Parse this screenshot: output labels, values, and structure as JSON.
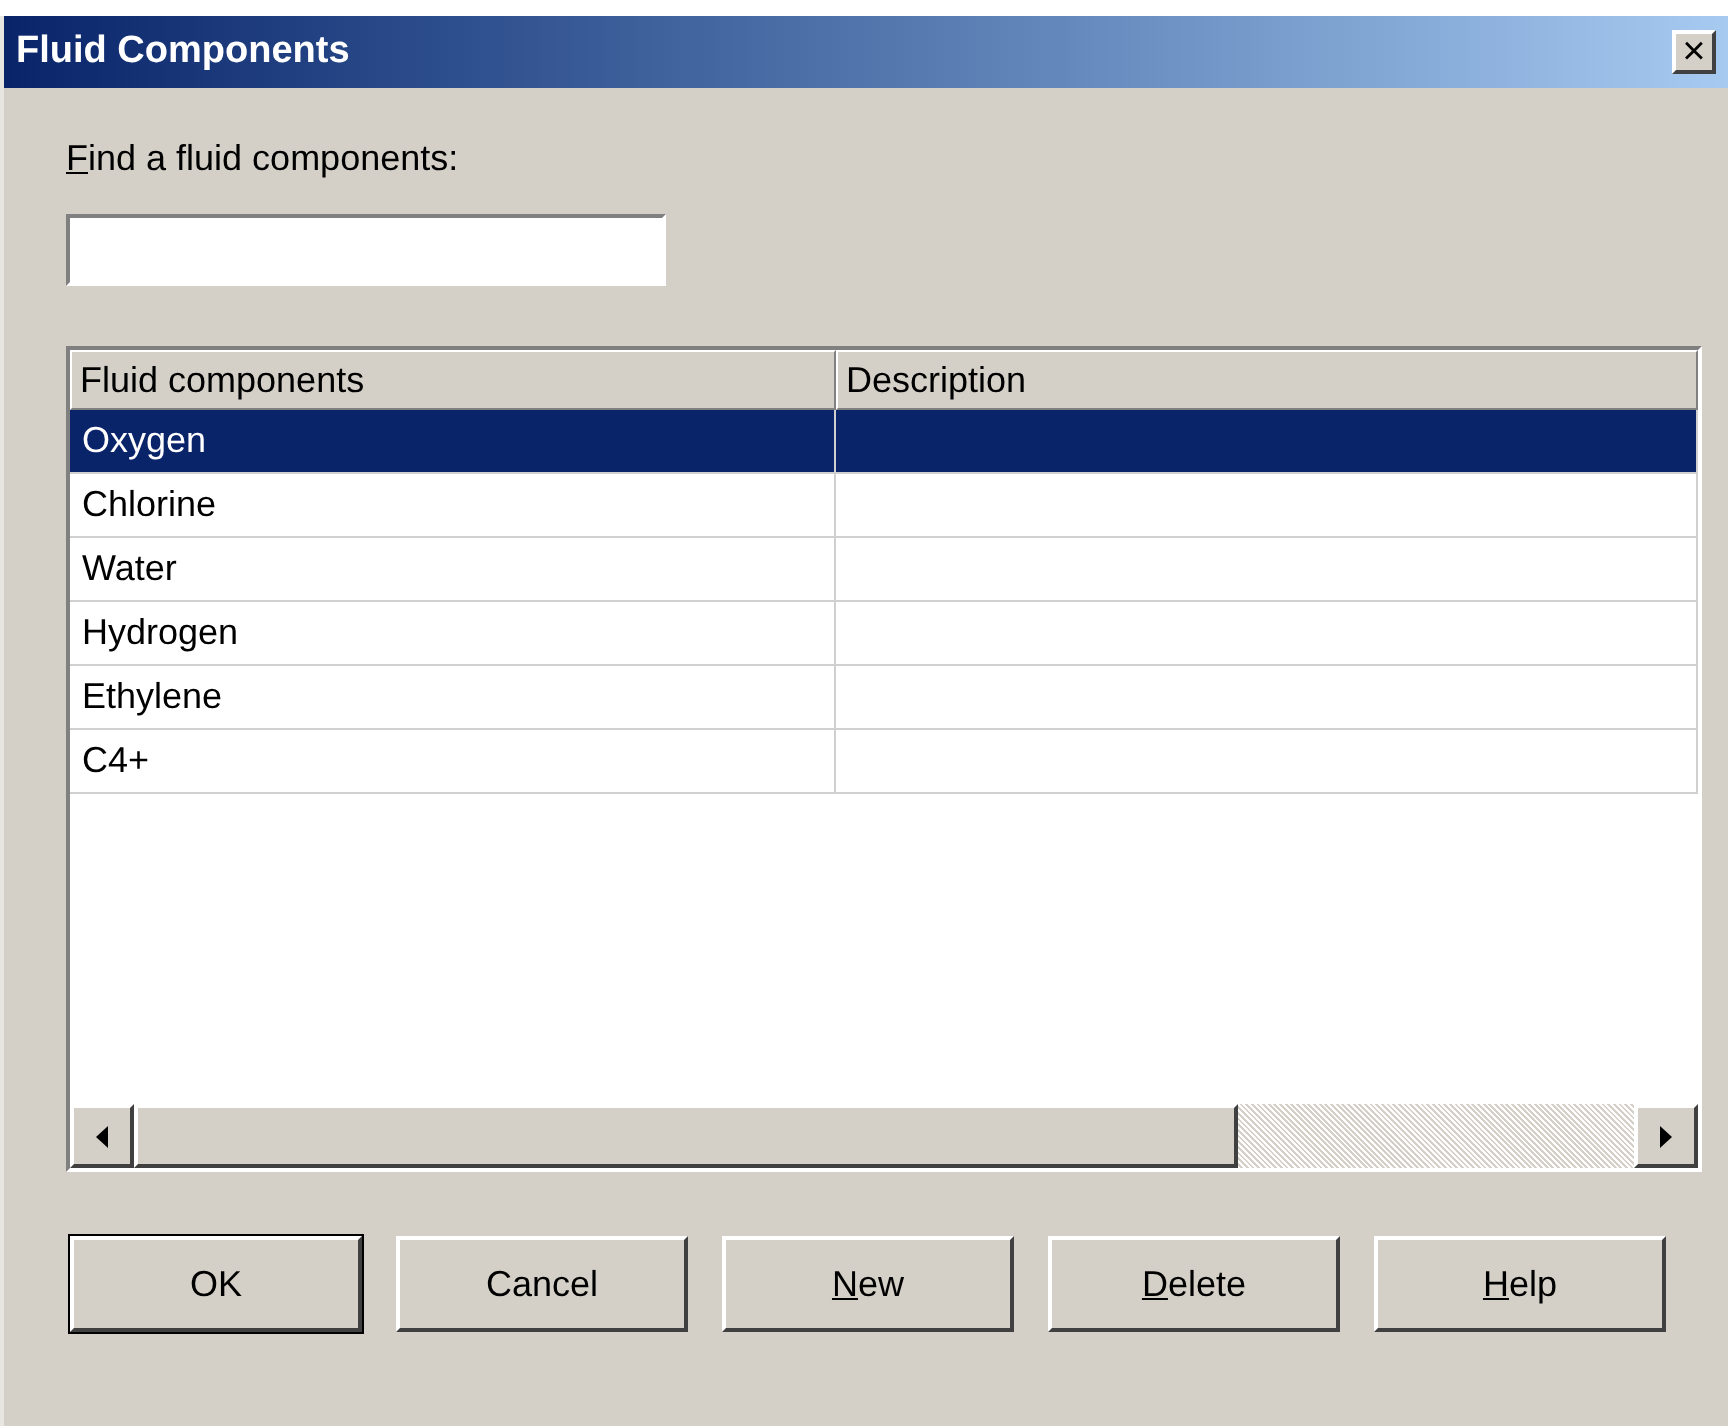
{
  "window": {
    "title": "Fluid Components",
    "close_symbol": "×"
  },
  "search": {
    "label": "Find a fluid components:",
    "label_access_key": true
  },
  "table": {
    "columns": [
      "Fluid components",
      "Description"
    ],
    "rows": [
      {
        "cells": [
          "Oxygen",
          ""
        ],
        "selected": true
      },
      {
        "cells": [
          "Chlorine",
          ""
        ],
        "selected": false
      },
      {
        "cells": [
          "Water",
          ""
        ],
        "selected": false
      },
      {
        "cells": [
          "Hydrogen",
          ""
        ],
        "selected": false
      },
      {
        "cells": [
          "Ethylene",
          ""
        ],
        "selected": false
      },
      {
        "cells": [
          "C4+",
          ""
        ],
        "selected": false
      }
    ]
  },
  "buttons": [
    {
      "label": "OK",
      "default": true,
      "access_key": false
    },
    {
      "label": "Cancel",
      "default": false,
      "access_key": false
    },
    {
      "label": "New",
      "default": false,
      "access_key": true
    },
    {
      "label": "Delete",
      "default": false,
      "access_key": true
    },
    {
      "label": "Help",
      "default": false,
      "access_key": true
    }
  ]
}
